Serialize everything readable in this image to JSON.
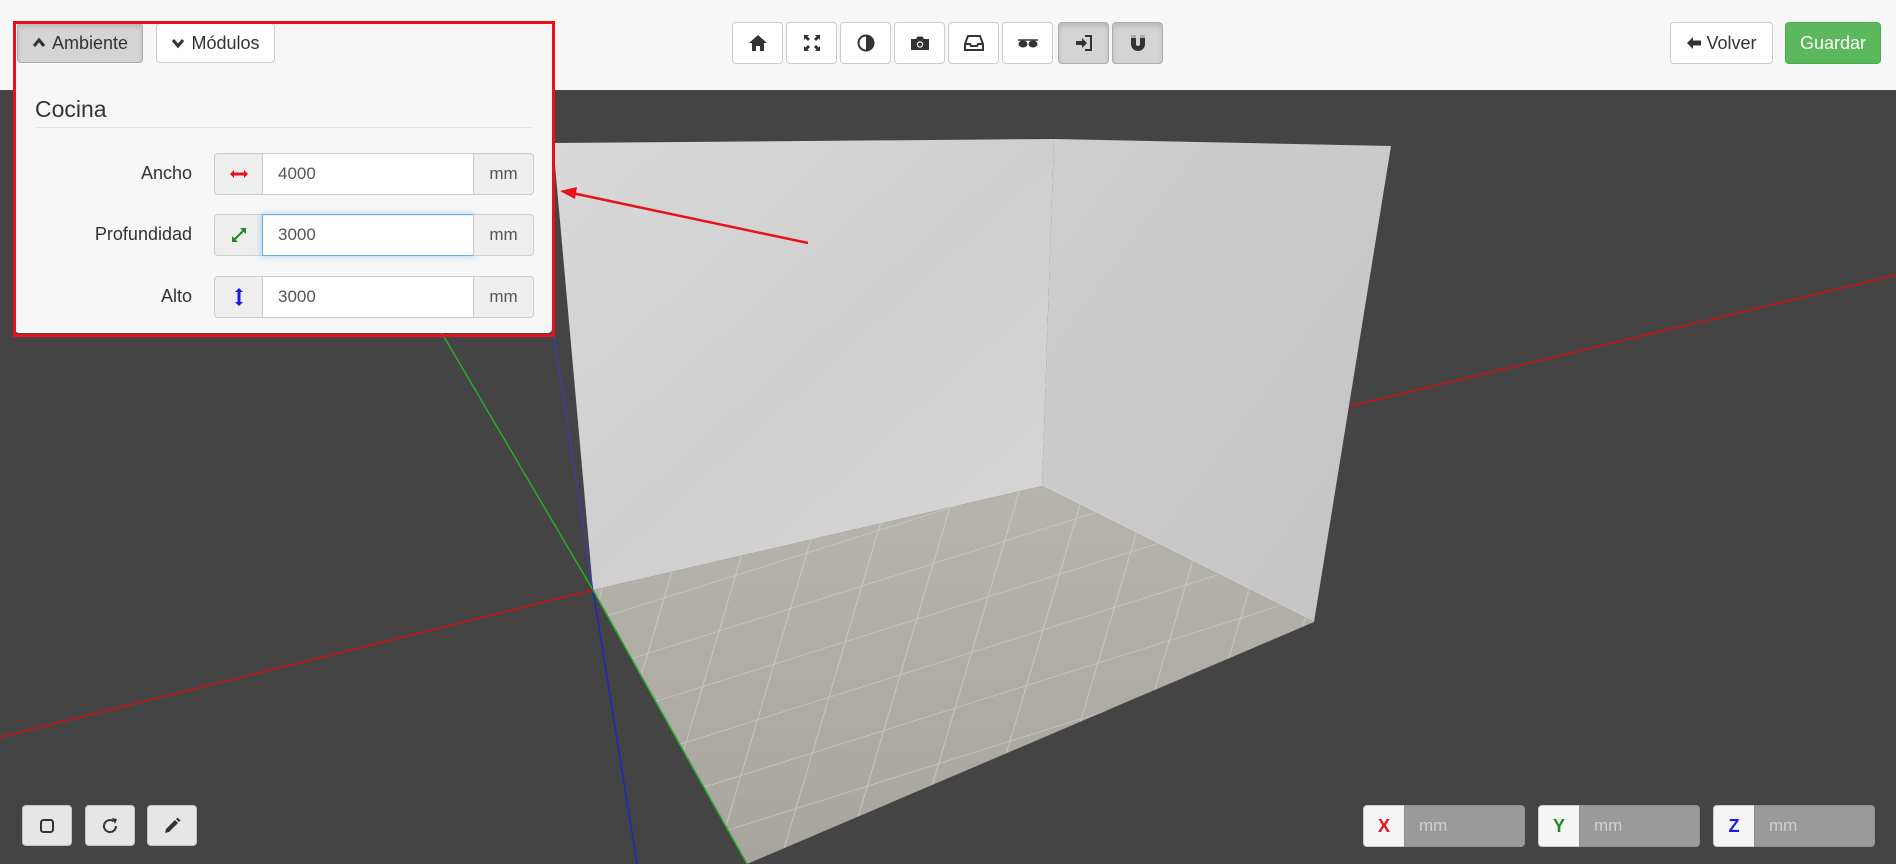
{
  "tabs": {
    "ambiente_label": "Ambiente",
    "modulos_label": "Módulos"
  },
  "toolbar": {
    "icons": [
      "home-icon",
      "expand-icon",
      "contrast-icon",
      "camera-icon",
      "inbox-icon",
      "glasses-icon",
      "sign-in-icon",
      "magnet-icon"
    ],
    "volver_label": "Volver",
    "guardar_label": "Guardar"
  },
  "ambiente": {
    "title": "Cocina",
    "rows": [
      {
        "label": "Ancho",
        "value": "4000",
        "unit": "mm",
        "icon": "horizontal-arrows-icon",
        "color": "#e8101a"
      },
      {
        "label": "Profundidad",
        "value": "3000",
        "unit": "mm",
        "icon": "diagonal-arrows-icon",
        "color": "#1e8a1e"
      },
      {
        "label": "Alto",
        "value": "3000",
        "unit": "mm",
        "icon": "vertical-arrows-icon",
        "color": "#1a1ae8"
      }
    ]
  },
  "bottom_left": {
    "icons": [
      "square-icon",
      "refresh-icon",
      "pencil-icon"
    ]
  },
  "coords": [
    {
      "axis": "X",
      "placeholder": "mm",
      "color": "#e8101a"
    },
    {
      "axis": "Y",
      "placeholder": "mm",
      "color": "#1e8a1e"
    },
    {
      "axis": "Z",
      "placeholder": "mm",
      "color": "#1a1ae8"
    }
  ],
  "colors": {
    "background": "#444444",
    "topbar": "#f7f7f7",
    "success": "#5cb85c",
    "annotation": "#e8101a"
  }
}
